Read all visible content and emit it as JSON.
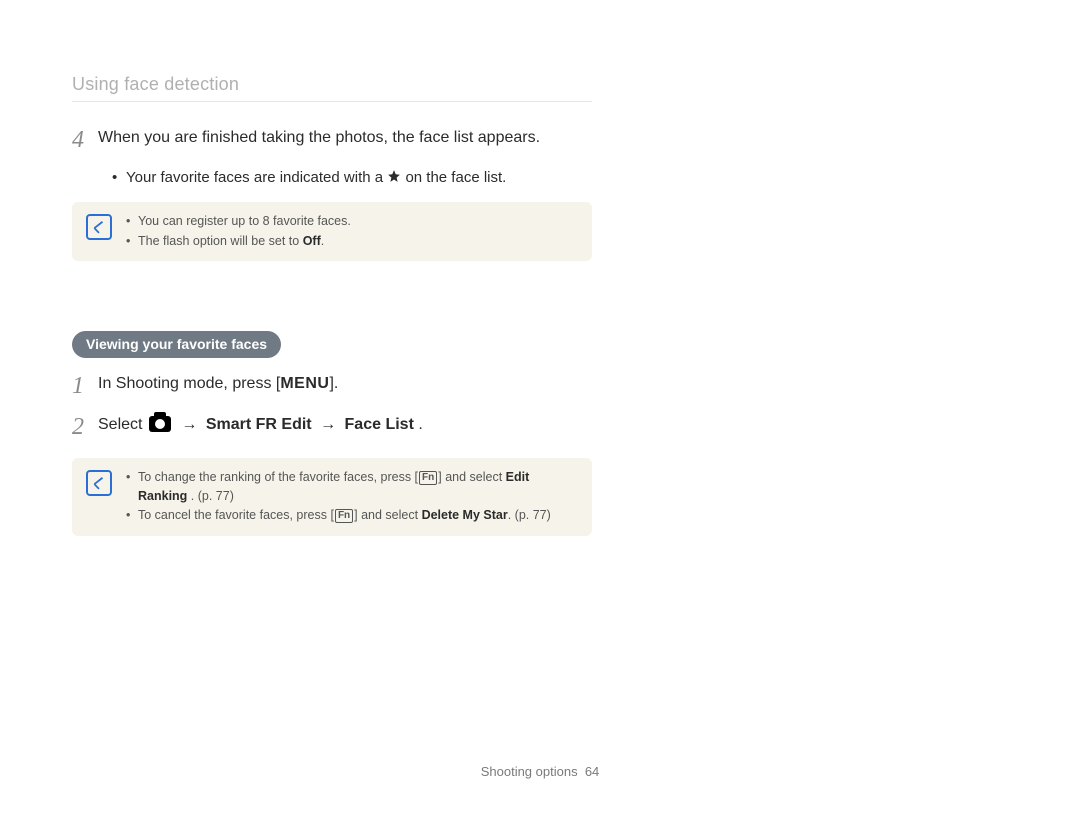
{
  "header": "Using face detection",
  "step4": {
    "num": "4",
    "text_a": "When you are finished taking the photos, the face list appears.",
    "sub_a_pre": "Your favorite faces are indicated with a ",
    "sub_a_post": " on the face list."
  },
  "note1": {
    "items": [
      "You can register up to 8 favorite faces.",
      "The flash option will be set to "
    ],
    "off": "Off",
    "period": "."
  },
  "pill": "Viewing your favorite faces",
  "step1": {
    "num": "1",
    "pre": "In Shooting mode, press [",
    "menu": "MENU",
    "post": "]."
  },
  "step2": {
    "num": "2",
    "select": "Select ",
    "arrow": "→",
    "smart": "Smart FR Edit",
    "face": "Face List",
    "end": " ."
  },
  "note2": {
    "line1_pre": "To change the ranking of the favorite faces, press [",
    "fn": "Fn",
    "line1_mid": "] and select ",
    "edit_ranking": "Edit Ranking",
    "line1_post": " . (p. 77)",
    "line2_pre": "To cancel the favorite faces, press [",
    "line2_mid": "] and select ",
    "delete_star": "Delete My Star",
    "line2_post": ". (p. 77)"
  },
  "footer": {
    "section": "Shooting options",
    "page": "64"
  }
}
